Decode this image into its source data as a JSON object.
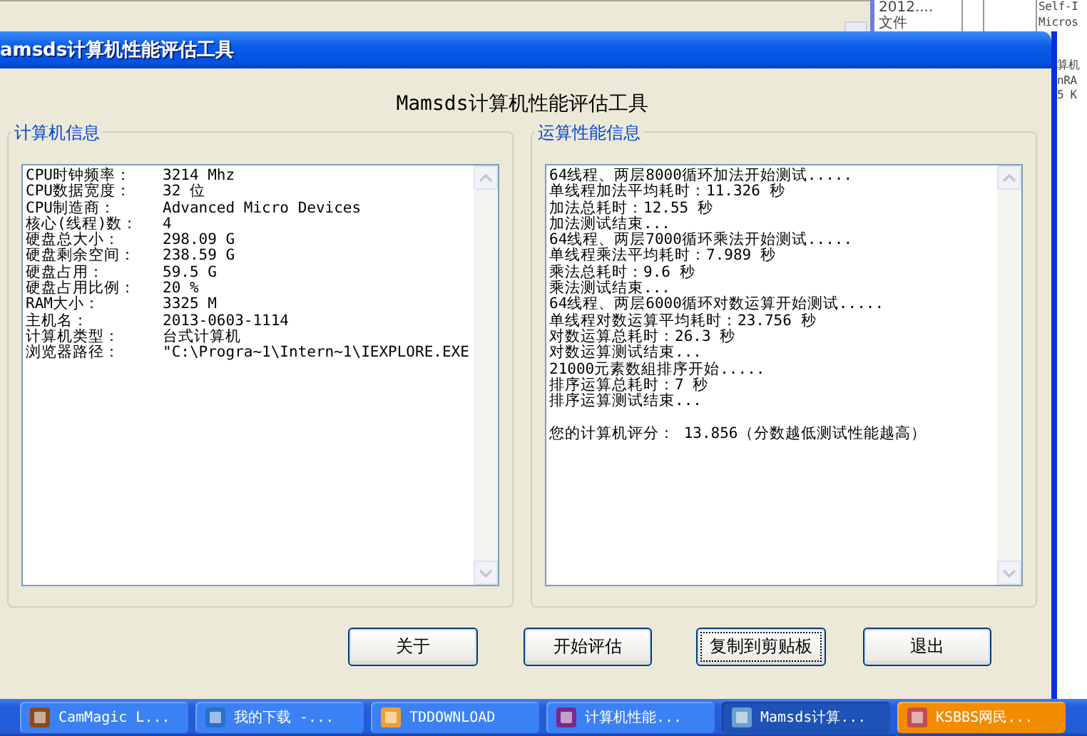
{
  "background_window": {
    "top_texts": [
      "2012....",
      "文件"
    ],
    "right_top_texts": [
      "Self-I",
      "Micros"
    ],
    "right_column": [
      "算机",
      "nRA",
      "5 K"
    ]
  },
  "window": {
    "title": "amsds计算机性能评估工具"
  },
  "heading": "Mamsds计算机性能评估工具",
  "system_info": {
    "title": "计算机信息",
    "rows": [
      {
        "label": "CPU时钟频率：",
        "value": "3214 Mhz"
      },
      {
        "label": "CPU数据宽度：",
        "value": "32 位"
      },
      {
        "label": "CPU制造商：",
        "value": "Advanced Micro Devices"
      },
      {
        "label": "核心(线程)数：",
        "value": "4"
      },
      {
        "label": "硬盘总大小：",
        "value": "298.09 G"
      },
      {
        "label": "硬盘剩余空间：",
        "value": "238.59 G"
      },
      {
        "label": "硬盘占用：",
        "value": "59.5 G"
      },
      {
        "label": "硬盘占用比例：",
        "value": "20 %"
      },
      {
        "label": "RAM大小：",
        "value": "3325 M"
      },
      {
        "label": "主机名：",
        "value": "2013-0603-1114"
      },
      {
        "label": "计算机类型：",
        "value": "台式计算机"
      },
      {
        "label": "浏览器路径：",
        "value": "\"C:\\Progra~1\\Intern~1\\IEXPLORE.EXE"
      }
    ]
  },
  "performance_info": {
    "title": "运算性能信息",
    "log_lines": [
      "64线程、两层8000循环加法开始测试.....",
      "单线程加法平均耗时：11.326 秒",
      "加法总耗时：12.55 秒",
      "加法测试结束...",
      "64线程、两层7000循环乘法开始测试.....",
      "单线程乘法平均耗时：7.989 秒",
      "乘法总耗时：9.6 秒",
      "乘法测试结束...",
      "64线程、两层6000循环对数运算开始测试.....",
      "单线程对数运算平均耗时：23.756 秒",
      "对数运算总耗时：26.3 秒",
      "对数运算测试结束...",
      "21000元素数組排序开始.....",
      "排序运算总耗时：7 秒",
      "排序运算测试结束..."
    ],
    "score_text": "您的计算机评分： 13.856（分数越低测试性能越高）"
  },
  "buttons": [
    {
      "label": "关于",
      "focused": false
    },
    {
      "label": "开始评估",
      "focused": false
    },
    {
      "label": "复制到剪贴板",
      "focused": true
    },
    {
      "label": "退出",
      "focused": false
    }
  ],
  "taskbar": {
    "items": [
      {
        "label": "CamMagic L...",
        "selected": false,
        "flashing": false
      },
      {
        "label": "我的下载 -...",
        "selected": false,
        "flashing": false
      },
      {
        "label": "TDDOWNLOAD",
        "selected": false,
        "flashing": false
      },
      {
        "label": "计算机性能...",
        "selected": false,
        "flashing": false
      },
      {
        "label": "Mamsds计算...",
        "selected": true,
        "flashing": false
      },
      {
        "label": "KSBBS网民...",
        "selected": false,
        "flashing": true
      }
    ]
  }
}
